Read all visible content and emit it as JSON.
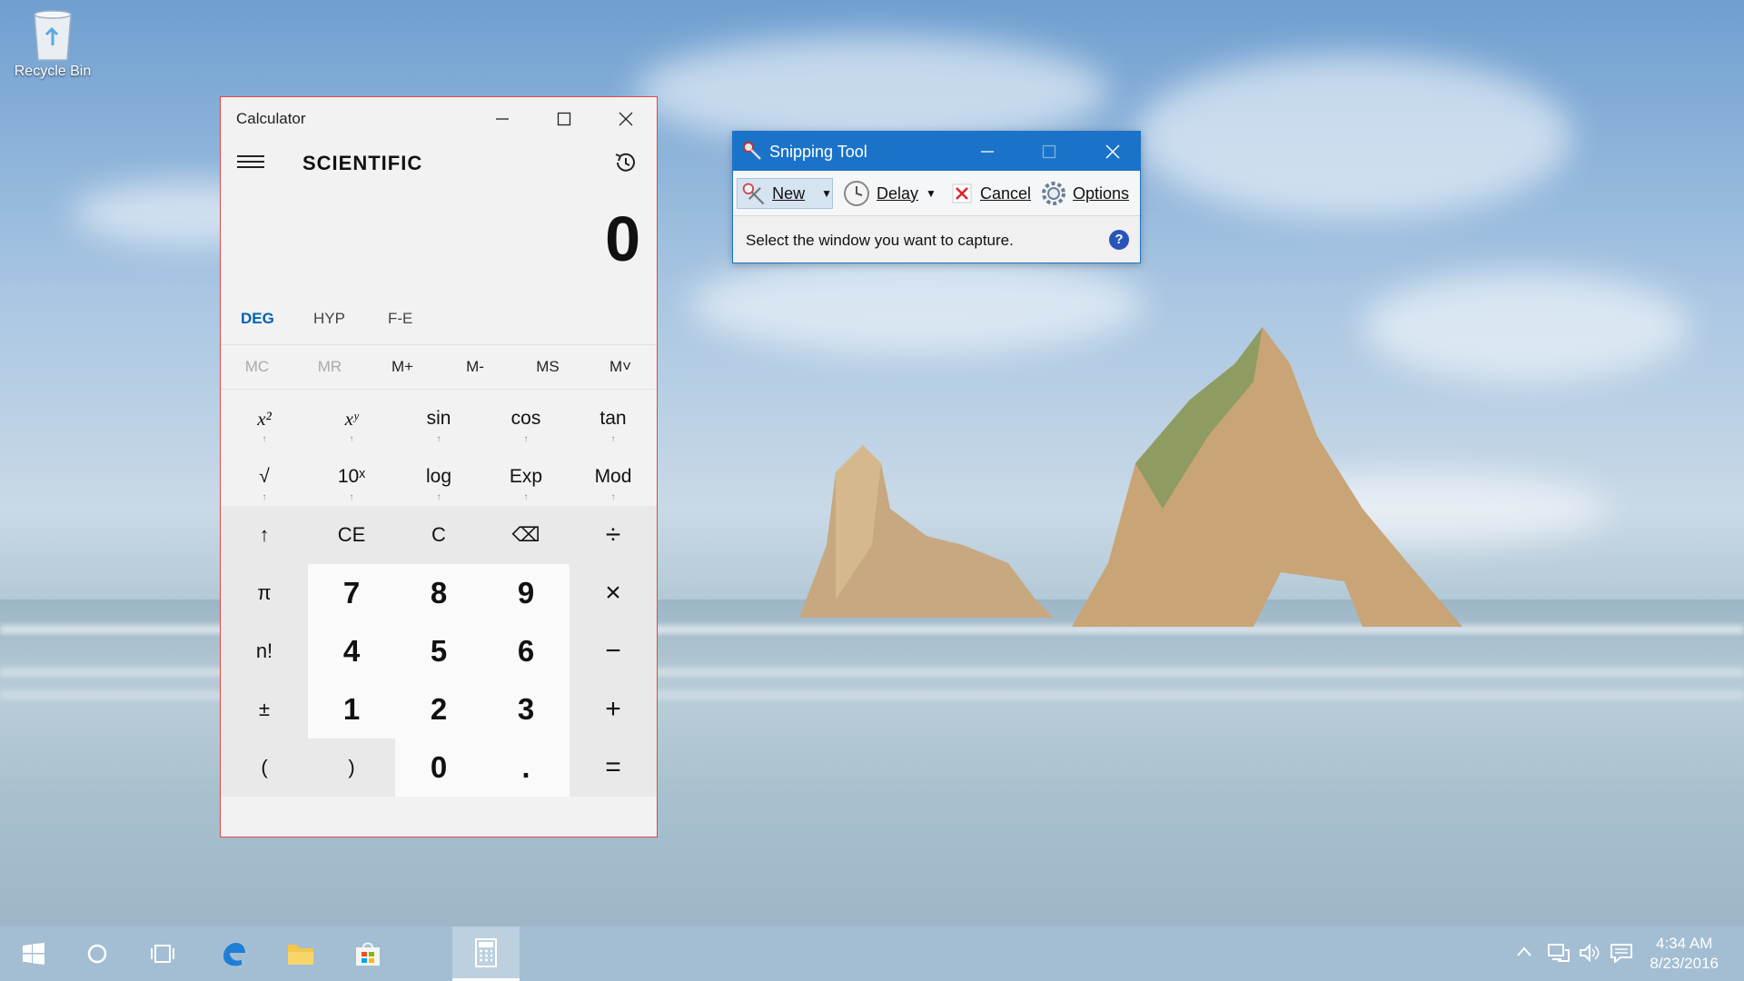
{
  "desktop": {
    "recycle_bin_label": "Recycle Bin"
  },
  "calculator": {
    "title": "Calculator",
    "mode": "SCIENTIFIC",
    "display": "0",
    "angle_buttons": [
      "DEG",
      "HYP",
      "F-E"
    ],
    "memory_buttons": [
      "MC",
      "MR",
      "M+",
      "M-",
      "MS",
      "M˅"
    ],
    "sci_rows": [
      [
        "x²",
        "xʸ",
        "sin",
        "cos",
        "tan"
      ],
      [
        "√",
        "10ˣ",
        "log",
        "Exp",
        "Mod"
      ]
    ],
    "main_rows": [
      [
        "↑",
        "CE",
        "C",
        "⌫",
        "÷"
      ],
      [
        "π",
        "7",
        "8",
        "9",
        "×"
      ],
      [
        "n!",
        "4",
        "5",
        "6",
        "−"
      ],
      [
        "±",
        "1",
        "2",
        "3",
        "+"
      ],
      [
        "(",
        ")",
        "0",
        ".",
        "="
      ]
    ]
  },
  "snipping_tool": {
    "title": "Snipping Tool",
    "new_label": "New",
    "delay_label": "Delay",
    "cancel_label": "Cancel",
    "options_label": "Options",
    "message": "Select the window you want to capture.",
    "help_glyph": "?"
  },
  "taskbar": {
    "time": "4:34 AM",
    "date": "8/23/2016"
  },
  "colors": {
    "accent": "#0063b1",
    "calculator_border": "#e04848",
    "snipping_titlebar": "#1a73c9"
  }
}
